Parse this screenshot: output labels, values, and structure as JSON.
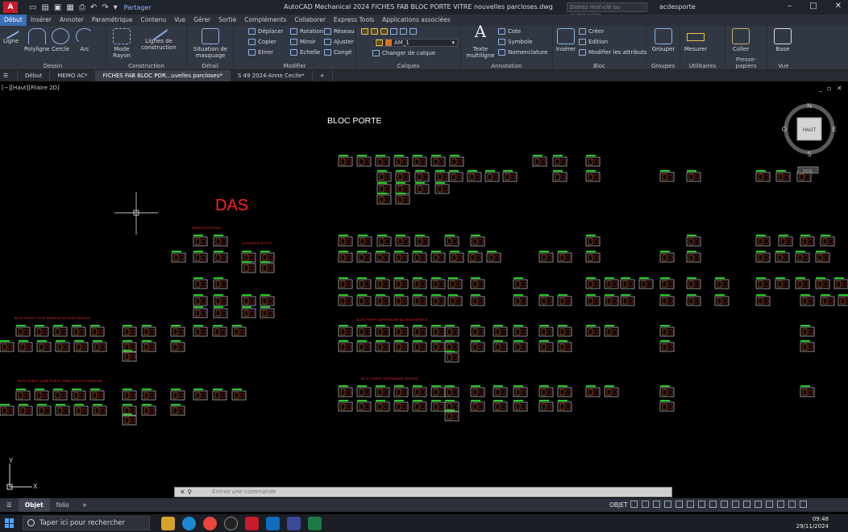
{
  "app": {
    "logo_letter": "A",
    "window_title": "AutoCAD Mechanical 2024   FICHES FAB BLOC PORTE VITRE nouvelles parcloses.dwg",
    "share_label": "Partager",
    "search_placeholder": "Entrez mot-clé ou expression",
    "user_name": "acdesporte"
  },
  "menu_tabs": [
    "Début",
    "Insérer",
    "Annoter",
    "Paramétrique",
    "Contenu",
    "Vue",
    "Gérer",
    "Sortie",
    "Compléments",
    "Collaborer",
    "Express Tools",
    "Applications associées"
  ],
  "ribbon": {
    "dessin": {
      "label": "Dessin",
      "tools": [
        "Ligne",
        "Polyligne",
        "Cercle",
        "Arc"
      ]
    },
    "construction": {
      "label": "Construction",
      "mode_rayon": "Mode Rayon",
      "lignes": "Lignes de construction"
    },
    "detail": {
      "label": "Détail",
      "situation": "Situation de masquage"
    },
    "modifier": {
      "label": "Modifier",
      "items": [
        "Déplacer",
        "Rotation",
        "Réseau",
        "Copier",
        "Miroir",
        "Ajuster",
        "Etirer",
        "Echelle",
        "Congé"
      ]
    },
    "calques": {
      "label": "Calques",
      "current_layer": "AM_1",
      "changer": "Changer de calque"
    },
    "annotation": {
      "label": "Annotation",
      "texte": "Texte multiligne",
      "cote": "Cote",
      "symbole": "Symbole",
      "nomenclature": "Nomenclature"
    },
    "bloc": {
      "label": "Bloc",
      "inserer": "Insérer",
      "creer": "Créer",
      "edition": "Edition",
      "attributs": "Modifier les attributs"
    },
    "groupes": {
      "label": "Groupes",
      "grouper": "Grouper"
    },
    "utilitaires": {
      "label": "Utilitaires",
      "mesurer": "Mesurer"
    },
    "presse": {
      "label": "Presse-papiers",
      "coller": "Coller"
    },
    "vue": {
      "label": "Vue",
      "base": "Base"
    }
  },
  "doc_tabs": [
    "Début",
    "MEMO AC*",
    "FICHES FAB BLOC POR...uvelles parcloses*",
    "S 49 2024-Anne Cecile*"
  ],
  "viewport": {
    "label": "[−][Haut][Filaire 2D]",
    "title": "BLOC PORTE",
    "das_label": "DAS",
    "red_labels": [
      "INSERTS ACTIONS",
      "CLOISON A PIVOTS",
      "BLOC PORTE VITRE PARAFEU ACCESS SERVICE",
      "BLOC PORTE SUPERIEURE ACCESS SERVICE",
      "BLOC PORTE VITRE PORTE SIMPLE ACCESS SERVICE",
      "BLOC PORTE SUPERIEURE ACCESS"
    ],
    "viewcube": {
      "top": "HAUT",
      "n": "N",
      "s": "S",
      "e": "E",
      "o": "O",
      "scu": "SCG"
    },
    "ucs": {
      "x": "X",
      "y": "Y"
    }
  },
  "command_placeholder": "Entrez une commande",
  "layout_tabs": [
    "Objet",
    "folio"
  ],
  "status": {
    "model": "OBJET"
  },
  "taskbar": {
    "search": "Taper ici pour rechercher",
    "time": "09:48",
    "date": "29/11/2024"
  }
}
